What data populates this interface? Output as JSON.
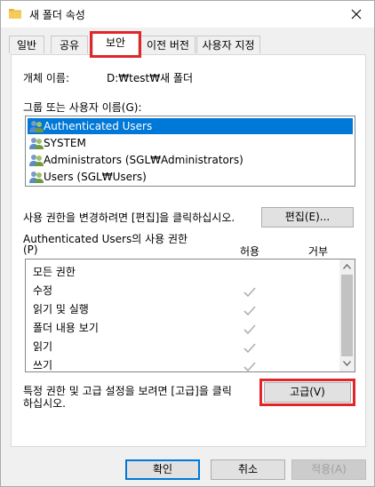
{
  "window": {
    "title": "새 폴더 속성",
    "close_icon": "close-icon"
  },
  "tabs": [
    {
      "label": "일반"
    },
    {
      "label": "공유"
    },
    {
      "label": "보안"
    },
    {
      "label": "이전 버전"
    },
    {
      "label": "사용자 지정"
    }
  ],
  "object": {
    "label": "개체 이름:",
    "value": "D:₩test₩새 폴더"
  },
  "users": {
    "label": "그룹 또는 사용자 이름(G):",
    "items": [
      {
        "name": "Authenticated Users",
        "selected": true
      },
      {
        "name": "SYSTEM",
        "selected": false
      },
      {
        "name": "Administrators (SGL₩Administrators)",
        "selected": false
      },
      {
        "name": "Users (SGL₩Users)",
        "selected": false
      }
    ]
  },
  "edit": {
    "hint": "사용 권한을 변경하려면 [편집]을 클릭하십시오.",
    "button": "편집(E)..."
  },
  "permissions": {
    "title": "Authenticated Users의 사용 권한",
    "shortcut": "(P)",
    "col_allow": "허용",
    "col_deny": "거부",
    "rows": [
      {
        "name": "모든 권한",
        "allow": false
      },
      {
        "name": "수정",
        "allow": true
      },
      {
        "name": "읽기 및 실행",
        "allow": true
      },
      {
        "name": "폴더 내용 보기",
        "allow": true
      },
      {
        "name": "읽기",
        "allow": true
      },
      {
        "name": "쓰기",
        "allow": true
      }
    ]
  },
  "advanced": {
    "hint_line1": "특정 권한 및 고급 설정을 보려면 [고급]을 클릭",
    "hint_line2": "하십시오.",
    "button": "고급(V)"
  },
  "footer": {
    "ok": "확인",
    "cancel": "취소",
    "apply": "적용(A)"
  },
  "colors": {
    "selection": "#0078d7",
    "highlight": "#e0262b",
    "check": "#b0b0b0"
  }
}
